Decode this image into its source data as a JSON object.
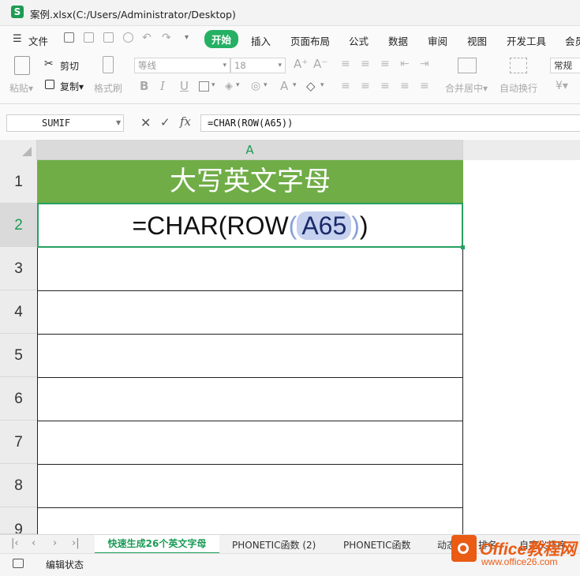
{
  "window": {
    "title": "案例.xlsx(C:/Users/Administrator/Desktop)",
    "app_icon": "S"
  },
  "menu": {
    "file": "文件",
    "items": [
      "开始",
      "插入",
      "页面布局",
      "公式",
      "数据",
      "审阅",
      "视图",
      "开发工具",
      "会员"
    ]
  },
  "ribbon": {
    "paste": "粘贴",
    "cut": "剪切",
    "copy": "复制",
    "format_painter": "格式刷",
    "font_name": "等线",
    "font_size": "18",
    "merge_center": "合并居中",
    "wrap_text": "自动换行",
    "number_format": "常规",
    "currency_symbol": "¥"
  },
  "formula_bar": {
    "name_box": "SUMIF",
    "formula": "=CHAR(ROW(A65))"
  },
  "sheet": {
    "column_header": "A",
    "rows": [
      "1",
      "2",
      "3",
      "4",
      "5",
      "6",
      "7",
      "8",
      "9"
    ],
    "a1": "大写英文字母",
    "a2_prefix": "=CHAR(ROW",
    "a2_paren_open": "(",
    "a2_ref": "A65",
    "a2_paren_close": ")",
    "a2_suffix": ")"
  },
  "sheet_tabs": [
    "快速生成26个英文字母",
    "PHONETIC函数 (2)",
    "PHONETIC函数",
    "动态",
    "排名",
    "自定义排序"
  ],
  "status": {
    "mode": "编辑状态"
  },
  "watermark": {
    "brand": "Office教程网",
    "url": "www.office26.com"
  },
  "colors": {
    "accent": "#25b064",
    "header_fill": "#70ad47",
    "ref_highlight": "#c5d1ee"
  }
}
